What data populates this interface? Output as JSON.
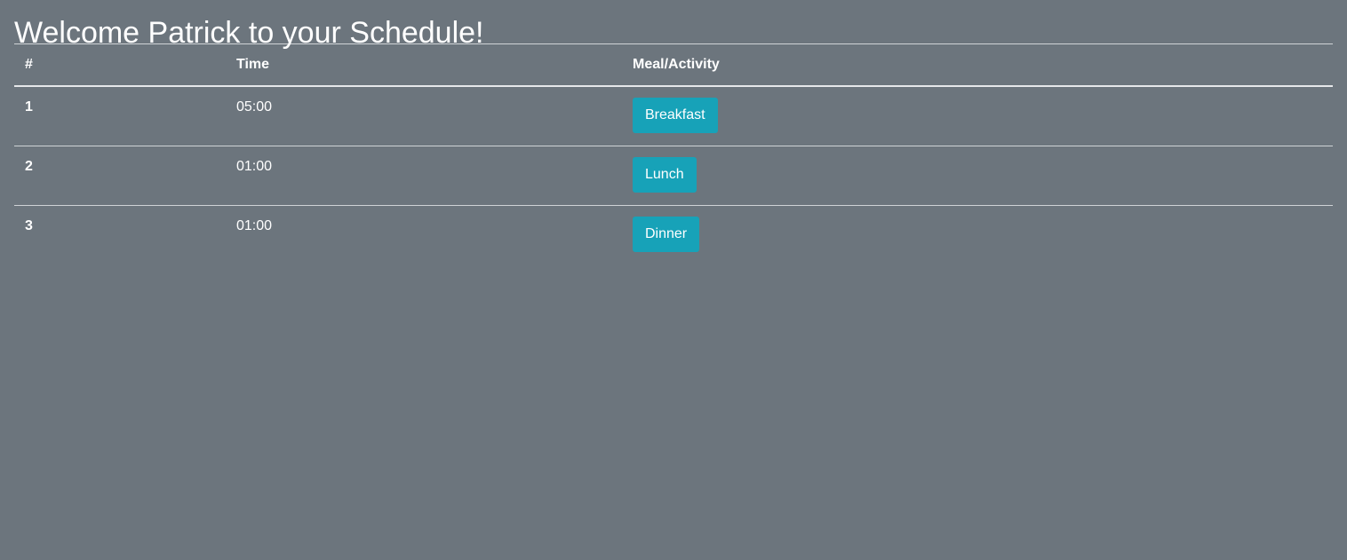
{
  "page": {
    "title": "Welcome Patrick to your Schedule!"
  },
  "table": {
    "headers": [
      "#",
      "Time",
      "Meal/Activity"
    ],
    "rows": [
      {
        "num": "1",
        "time": "05:00",
        "activity": "Breakfast"
      },
      {
        "num": "2",
        "time": "01:00",
        "activity": "Lunch"
      },
      {
        "num": "3",
        "time": "01:00",
        "activity": "Dinner"
      }
    ]
  },
  "colors": {
    "background": "#6c757d",
    "button": "#17a2b8",
    "text": "#ffffff"
  }
}
